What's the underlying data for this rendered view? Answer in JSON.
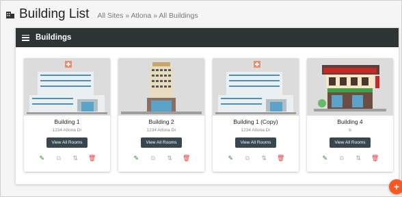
{
  "header": {
    "title": "Building List",
    "breadcrumb": [
      "All Sites",
      "Atlona",
      "All Buildings"
    ],
    "separator": "»"
  },
  "panel": {
    "title": "Buildings"
  },
  "buildings": [
    {
      "name": "Building 1",
      "address": "1234 Atlona Dr",
      "button": "View All Rooms",
      "image": "hospital"
    },
    {
      "name": "Building 2",
      "address": "1234 Atlona Dr",
      "button": "View All Rooms",
      "image": "hotel-tower"
    },
    {
      "name": "Building 1 (Copy)",
      "address": "1234 Atlona Dr",
      "button": "View All Rooms",
      "image": "hospital"
    },
    {
      "name": "Building 4",
      "address": "b",
      "button": "View All Rooms",
      "image": "shop"
    }
  ],
  "icons": {
    "edit": "pencil-icon",
    "copy": "copy-icon",
    "move": "move-icon",
    "delete": "trash-icon",
    "fab": "add-icon"
  },
  "fab_label": "+",
  "colors": {
    "panel_header": "#2d3436",
    "button": "#37474f",
    "edit": "#2e7d32",
    "delete": "#e53935",
    "fab": "#ff5722"
  }
}
